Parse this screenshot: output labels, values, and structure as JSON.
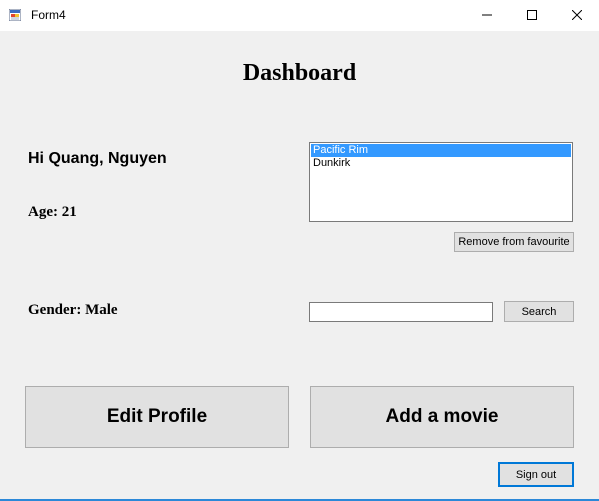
{
  "window": {
    "title": "Form4",
    "controls": {
      "minimize": "minimize-icon",
      "maximize": "maximize-icon",
      "close": "close-icon"
    }
  },
  "dashboard": {
    "title": "Dashboard",
    "greeting": "Hi Quang, Nguyen",
    "age": "Age: 21",
    "gender": "Gender: Male"
  },
  "favourites": {
    "items": [
      "Pacific Rim",
      "Dunkirk"
    ],
    "selected": "Pacific Rim",
    "remove_label": "Remove from favourite"
  },
  "search": {
    "value": "",
    "placeholder": "",
    "button_label": "Search"
  },
  "actions": {
    "edit_profile": "Edit Profile",
    "add_movie": "Add a movie",
    "sign_out": "Sign out"
  },
  "colors": {
    "selection": "#3399ff",
    "accent": "#0078d7",
    "background": "#f0f0f0"
  }
}
